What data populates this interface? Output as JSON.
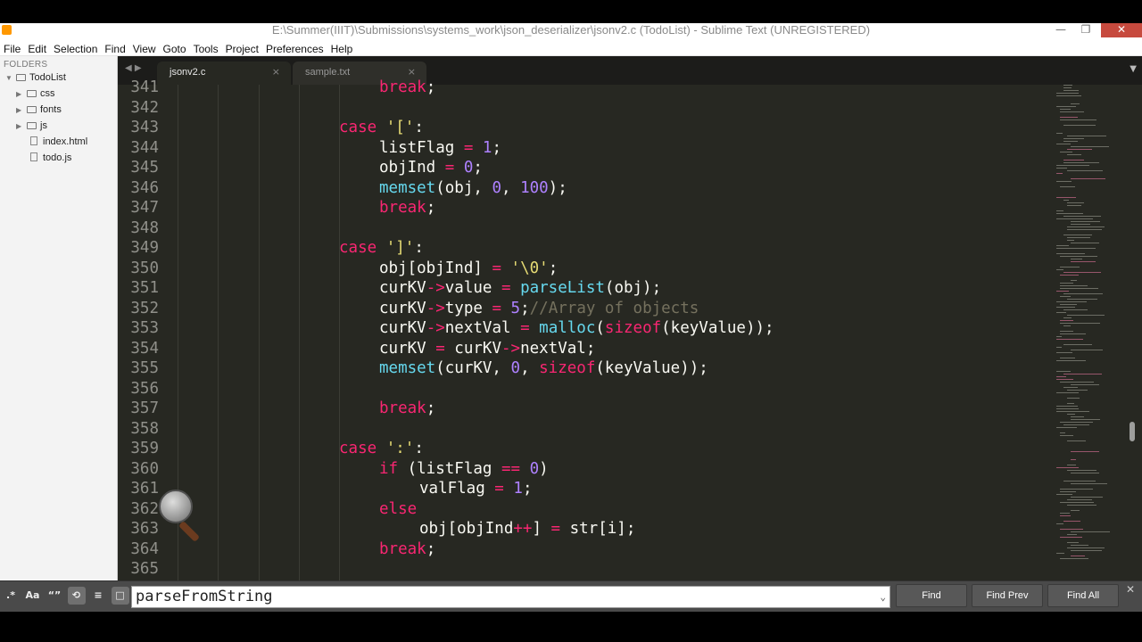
{
  "window": {
    "title": "E:\\Summer(IIIT)\\Submissions\\systems_work\\json_deserializer\\jsonv2.c (TodoList) - Sublime Text (UNREGISTERED)",
    "minimize": "—",
    "restore": "❐",
    "close": "✕"
  },
  "menu": [
    "File",
    "Edit",
    "Selection",
    "Find",
    "View",
    "Goto",
    "Tools",
    "Project",
    "Preferences",
    "Help"
  ],
  "sidebar": {
    "header": "FOLDERS",
    "root": "TodoList",
    "folders": [
      "css",
      "fonts",
      "js"
    ],
    "files": [
      "index.html",
      "todo.js"
    ]
  },
  "tabs": [
    {
      "label": "jsonv2.c",
      "active": true,
      "close": "×"
    },
    {
      "label": "sample.txt",
      "active": false,
      "close": "×"
    }
  ],
  "nav_arrows": "◀ ▶",
  "tab_dropdown": "▼",
  "code_lines": [
    {
      "n": "341",
      "tokens": [
        [
          "kw",
          "break"
        ],
        [
          "txt",
          ";"
        ]
      ]
    },
    {
      "n": "342",
      "tokens": []
    },
    {
      "n": "343",
      "tokens": [
        [
          "kw",
          "case"
        ],
        [
          "txt",
          " "
        ],
        [
          "str",
          "'['"
        ],
        [
          "txt",
          ":"
        ]
      ]
    },
    {
      "n": "344",
      "tokens": [
        [
          "txt",
          "listFlag "
        ],
        [
          "kw",
          "="
        ],
        [
          "txt",
          " "
        ],
        [
          "num",
          "1"
        ],
        [
          "txt",
          ";"
        ]
      ]
    },
    {
      "n": "345",
      "tokens": [
        [
          "txt",
          "objInd "
        ],
        [
          "kw",
          "="
        ],
        [
          "txt",
          " "
        ],
        [
          "num",
          "0"
        ],
        [
          "txt",
          ";"
        ]
      ]
    },
    {
      "n": "346",
      "tokens": [
        [
          "fn",
          "memset"
        ],
        [
          "txt",
          "(obj, "
        ],
        [
          "num",
          "0"
        ],
        [
          "txt",
          ", "
        ],
        [
          "num",
          "100"
        ],
        [
          "txt",
          ");"
        ]
      ]
    },
    {
      "n": "347",
      "tokens": [
        [
          "kw",
          "break"
        ],
        [
          "txt",
          ";"
        ]
      ]
    },
    {
      "n": "348",
      "tokens": []
    },
    {
      "n": "349",
      "tokens": [
        [
          "kw",
          "case"
        ],
        [
          "txt",
          " "
        ],
        [
          "str",
          "']'"
        ],
        [
          "txt",
          ":"
        ]
      ]
    },
    {
      "n": "350",
      "tokens": [
        [
          "txt",
          "obj[objInd] "
        ],
        [
          "kw",
          "="
        ],
        [
          "txt",
          " "
        ],
        [
          "str",
          "'\\0'"
        ],
        [
          "txt",
          ";"
        ]
      ]
    },
    {
      "n": "351",
      "tokens": [
        [
          "txt",
          "curKV"
        ],
        [
          "kw",
          "->"
        ],
        [
          "txt",
          "value "
        ],
        [
          "kw",
          "="
        ],
        [
          "txt",
          " "
        ],
        [
          "fn",
          "parseList"
        ],
        [
          "txt",
          "(obj);"
        ]
      ]
    },
    {
      "n": "352",
      "tokens": [
        [
          "txt",
          "curKV"
        ],
        [
          "kw",
          "->"
        ],
        [
          "txt",
          "type "
        ],
        [
          "kw",
          "="
        ],
        [
          "txt",
          " "
        ],
        [
          "num",
          "5"
        ],
        [
          "txt",
          ";"
        ],
        [
          "cmt",
          "//Array of objects"
        ]
      ]
    },
    {
      "n": "353",
      "tokens": [
        [
          "txt",
          "curKV"
        ],
        [
          "kw",
          "->"
        ],
        [
          "txt",
          "nextVal "
        ],
        [
          "kw",
          "="
        ],
        [
          "txt",
          " "
        ],
        [
          "fn",
          "malloc"
        ],
        [
          "txt",
          "("
        ],
        [
          "kw",
          "sizeof"
        ],
        [
          "txt",
          "(keyValue));"
        ]
      ]
    },
    {
      "n": "354",
      "tokens": [
        [
          "txt",
          "curKV "
        ],
        [
          "kw",
          "="
        ],
        [
          "txt",
          " curKV"
        ],
        [
          "kw",
          "->"
        ],
        [
          "txt",
          "nextVal;"
        ]
      ]
    },
    {
      "n": "355",
      "tokens": [
        [
          "fn",
          "memset"
        ],
        [
          "txt",
          "(curKV, "
        ],
        [
          "num",
          "0"
        ],
        [
          "txt",
          ", "
        ],
        [
          "kw",
          "sizeof"
        ],
        [
          "txt",
          "(keyValue));"
        ]
      ]
    },
    {
      "n": "356",
      "tokens": []
    },
    {
      "n": "357",
      "tokens": [
        [
          "kw",
          "break"
        ],
        [
          "txt",
          ";"
        ]
      ]
    },
    {
      "n": "358",
      "tokens": []
    },
    {
      "n": "359",
      "tokens": [
        [
          "kw",
          "case"
        ],
        [
          "txt",
          " "
        ],
        [
          "str",
          "':'"
        ],
        [
          "txt",
          ":"
        ]
      ]
    },
    {
      "n": "360",
      "tokens": [
        [
          "kw",
          "if"
        ],
        [
          "txt",
          " (listFlag "
        ],
        [
          "kw",
          "=="
        ],
        [
          "txt",
          " "
        ],
        [
          "num",
          "0"
        ],
        [
          "txt",
          ")"
        ]
      ]
    },
    {
      "n": "361",
      "tokens": [
        [
          "txt",
          "valFlag "
        ],
        [
          "kw",
          "="
        ],
        [
          "txt",
          " "
        ],
        [
          "num",
          "1"
        ],
        [
          "txt",
          ";"
        ]
      ]
    },
    {
      "n": "362",
      "tokens": [
        [
          "kw",
          "else"
        ]
      ]
    },
    {
      "n": "363",
      "tokens": [
        [
          "txt",
          "obj[objInd"
        ],
        [
          "kw",
          "++"
        ],
        [
          "txt",
          "] "
        ],
        [
          "kw",
          "="
        ],
        [
          "txt",
          " str[i];"
        ]
      ]
    },
    {
      "n": "364",
      "tokens": [
        [
          "kw",
          "break"
        ],
        [
          "txt",
          ";"
        ]
      ]
    },
    {
      "n": "365",
      "tokens": []
    }
  ],
  "find_bar": {
    "options": [
      ".*",
      "Aa",
      "“”",
      "⟲",
      "≡",
      "□"
    ],
    "query": "parseFromString",
    "buttons": [
      "Find",
      "Find Prev",
      "Find All"
    ],
    "close": "✕",
    "dropdown": "⌄"
  },
  "colors": {
    "keyword": "#f92672",
    "function": "#66d9ef",
    "number": "#ae81ff",
    "string": "#e6db74",
    "comment": "#75715e",
    "background": "#272822"
  }
}
